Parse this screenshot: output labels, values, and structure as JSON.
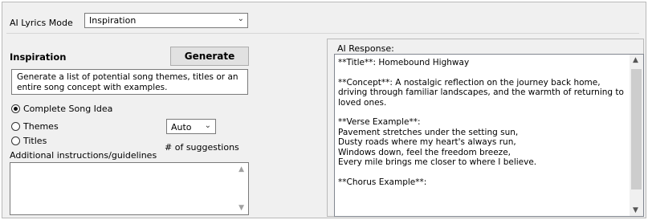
{
  "mode": {
    "label": "AI Lyrics Mode",
    "value": "Inspiration"
  },
  "inspiration": {
    "title": "Inspiration",
    "generate_label": "Generate",
    "description": "Generate a list of potential song themes, titles or an entire song concept with examples.",
    "options": [
      {
        "label": "Complete Song Idea",
        "selected": true
      },
      {
        "label": "Themes",
        "selected": false
      },
      {
        "label": "Titles",
        "selected": false
      }
    ],
    "suggestions_value": "Auto",
    "suggestions_label": "# of suggestions",
    "instructions_label": "Additional instructions/guidelines",
    "instructions_value": ""
  },
  "response": {
    "label": "AI Response:",
    "text": "**Title**: Homebound Highway\n\n**Concept**: A nostalgic reflection on the journey back home, driving through familiar landscapes, and the warmth of returning to loved ones.\n\n**Verse Example**:\nPavement stretches under the setting sun,\nDusty roads where my heart's always run,\nWindows down, feel the freedom breeze,\nEvery mile brings me closer to where I believe.\n\n**Chorus Example**:"
  }
}
